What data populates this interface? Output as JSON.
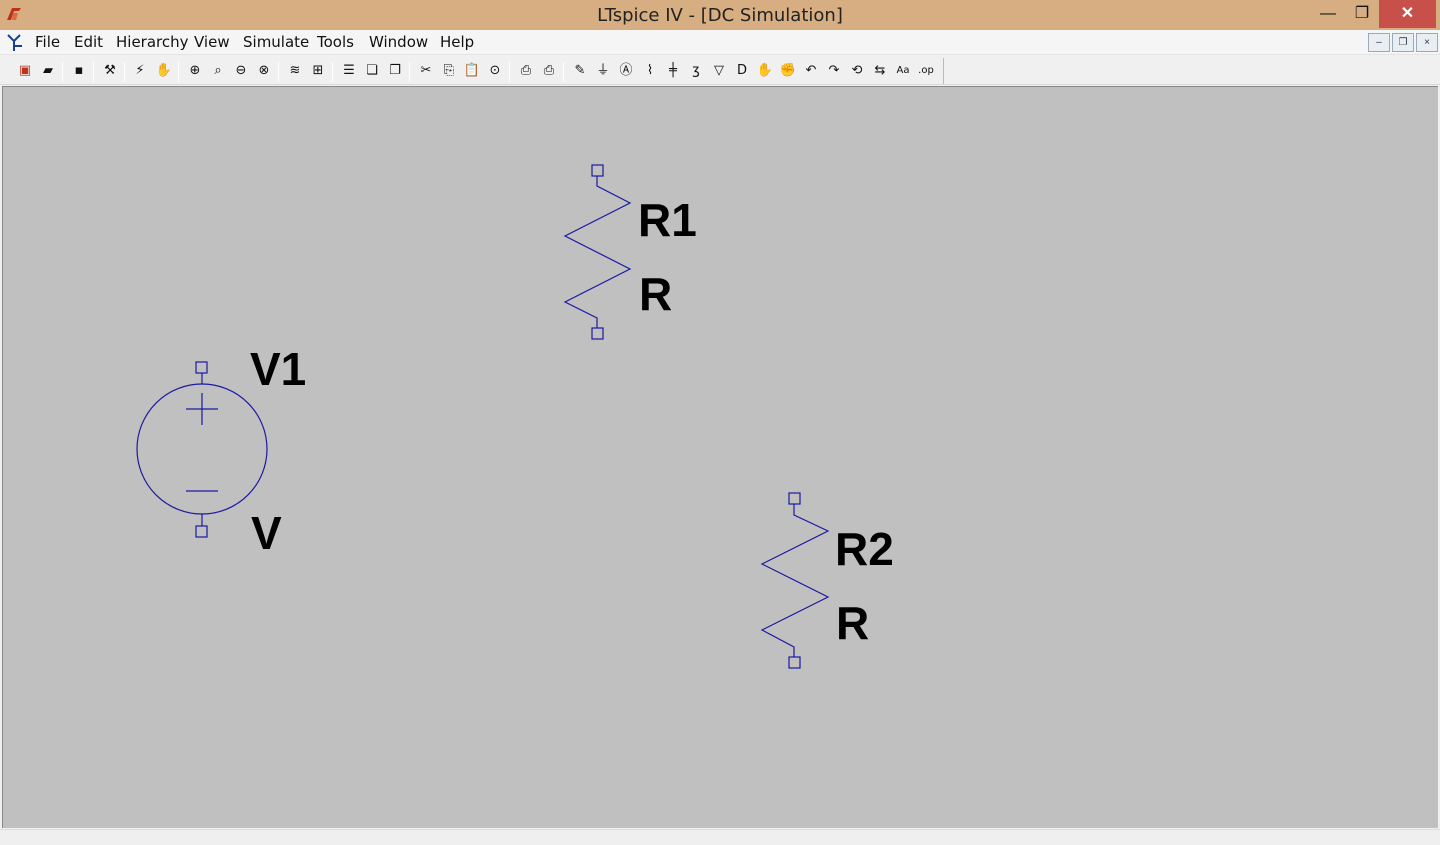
{
  "window": {
    "title": "LTspice IV - [DC Simulation]",
    "controls": {
      "minimize": "—",
      "maximize": "❐",
      "close": "✕"
    }
  },
  "menubar": {
    "items": [
      {
        "label": "File"
      },
      {
        "label": "Edit"
      },
      {
        "label": "Hierarchy"
      },
      {
        "label": "View"
      },
      {
        "label": "Simulate"
      },
      {
        "label": "Tools"
      },
      {
        "label": "Window"
      },
      {
        "label": "Help"
      }
    ],
    "mdi_controls": {
      "minimize": "–",
      "restore": "❐",
      "close": "×"
    }
  },
  "toolbar": {
    "buttons": [
      {
        "icon": "new-schematic-icon",
        "glyph": "▣"
      },
      {
        "icon": "open-folder-icon",
        "glyph": "▰"
      },
      {
        "icon": "save-icon",
        "glyph": "▪"
      },
      {
        "icon": "control-panel-icon",
        "glyph": "⚒"
      },
      {
        "icon": "run-icon",
        "glyph": "⚡"
      },
      {
        "icon": "halt-icon",
        "glyph": "✋"
      },
      {
        "icon": "zoom-in-icon",
        "glyph": "⊕"
      },
      {
        "icon": "zoom-fit-icon",
        "glyph": "⌕"
      },
      {
        "icon": "zoom-out-icon",
        "glyph": "⊖"
      },
      {
        "icon": "zoom-cancel-icon",
        "glyph": "⊗"
      },
      {
        "icon": "autoscale-icon",
        "glyph": "≋"
      },
      {
        "icon": "delete-plot-icon",
        "glyph": "⊞"
      },
      {
        "icon": "tile-horizontal-icon",
        "glyph": "☰"
      },
      {
        "icon": "cascade-icon",
        "glyph": "❏"
      },
      {
        "icon": "tile-vertical-icon",
        "glyph": "❐"
      },
      {
        "icon": "cut-icon",
        "glyph": "✂"
      },
      {
        "icon": "copy-icon",
        "glyph": "⎘"
      },
      {
        "icon": "paste-icon",
        "glyph": "📋"
      },
      {
        "icon": "find-icon",
        "glyph": "⊙"
      },
      {
        "icon": "print-preview-icon",
        "glyph": "⎙"
      },
      {
        "icon": "print-icon",
        "glyph": "⎙"
      },
      {
        "icon": "draw-wire-icon",
        "glyph": "✎"
      },
      {
        "icon": "ground-icon",
        "glyph": "⏚"
      },
      {
        "icon": "label-net-icon",
        "glyph": "Ⓐ"
      },
      {
        "icon": "resistor-icon",
        "glyph": "⌇"
      },
      {
        "icon": "capacitor-icon",
        "glyph": "╪"
      },
      {
        "icon": "inductor-icon",
        "glyph": "ʒ"
      },
      {
        "icon": "diode-icon",
        "glyph": "▽"
      },
      {
        "icon": "component-icon",
        "glyph": "D"
      },
      {
        "icon": "move-icon",
        "glyph": "✋"
      },
      {
        "icon": "drag-icon",
        "glyph": "✊"
      },
      {
        "icon": "undo-icon",
        "glyph": "↶"
      },
      {
        "icon": "redo-icon",
        "glyph": "↷"
      },
      {
        "icon": "rotate-icon",
        "glyph": "⟲"
      },
      {
        "icon": "mirror-icon",
        "glyph": "⇆"
      },
      {
        "icon": "text-icon",
        "glyph": "Aa"
      },
      {
        "icon": "spice-directive-icon",
        "glyph": ".op"
      }
    ]
  },
  "schematic": {
    "wire_color": "#1a1aa0",
    "components": [
      {
        "id": "V1",
        "type": "voltage-source",
        "name": "V1",
        "value": "V"
      },
      {
        "id": "R1",
        "type": "resistor",
        "name": "R1",
        "value": "R"
      },
      {
        "id": "R2",
        "type": "resistor",
        "name": "R2",
        "value": "R"
      }
    ]
  }
}
